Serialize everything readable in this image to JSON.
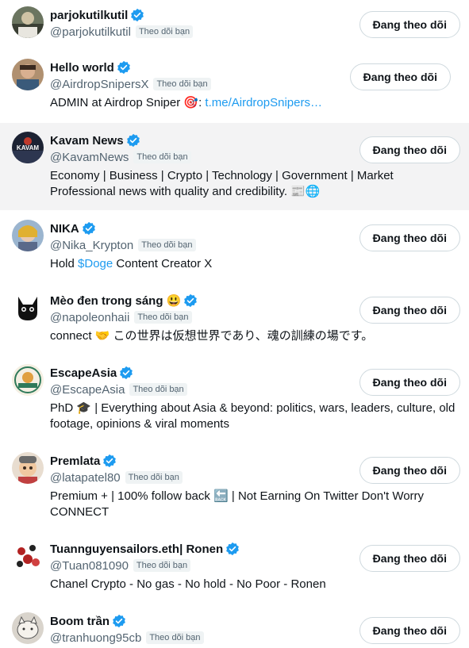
{
  "follow_label": "Đang theo dõi",
  "follows_you_label": "Theo dõi bạn",
  "users": [
    {
      "name": "parjokutilkutil",
      "handle": "@parjokutilkutil",
      "follows_you": true,
      "bio": "",
      "avatar_color": "#4a5a3a"
    },
    {
      "name": "Hello world",
      "handle": "@AirdropSnipersX",
      "follows_you": true,
      "bio_prefix": "ADMIN at Airdrop Sniper 🎯: ",
      "bio_link": "t.me/AirdropSnipers…",
      "avatar_color": "#8a6a5a"
    },
    {
      "name": "Kavam News",
      "handle": "@KavamNews",
      "follows_you": true,
      "bio": "Economy | Business | Crypto | Technology | Government | Market Professional news with quality and credibility. 📰🌐",
      "avatar_text": "KAVAM",
      "avatar_color": "#1c2233"
    },
    {
      "name": "NIKA",
      "handle": "@Nika_Krypton",
      "follows_you": true,
      "bio_prefix": "Hold ",
      "bio_link": "$Doge",
      "bio_suffix": " Content Creator X",
      "avatar_color": "#7f9bb8"
    },
    {
      "name": "Mèo đen trong sáng",
      "name_emoji": "😃",
      "handle": "@napoleonhaii",
      "follows_you": true,
      "bio": "connect 🤝 この世界は仮想世界であり、魂の訓練の場です。",
      "avatar_color": "#111111"
    },
    {
      "name": "EscapeAsia",
      "handle": "@EscapeAsia",
      "follows_you": true,
      "bio": "PhD 🎓 | Everything about Asia & beyond: politics, wars, leaders, culture, old footage, opinions & viral moments",
      "avatar_color": "#f4efe2"
    },
    {
      "name": "Premlata",
      "handle": "@latapatel80",
      "follows_you": true,
      "bio": "Premium + | 100% follow back 🔙 | Not Earning On Twitter Don't Worry CONNECT",
      "avatar_color": "#c9a27a"
    },
    {
      "name": "Tuannguyensailors.eth| Ronen",
      "handle": "@Tuan081090",
      "follows_you": true,
      "bio": "Chanel Crypto - No gas - No hold - No Poor - Ronen",
      "avatar_color": "#b22222"
    },
    {
      "name": "Boom trần",
      "handle": "@tranhuong95cb",
      "follows_you": true,
      "bio": "",
      "avatar_color": "#d9d4cc"
    }
  ]
}
